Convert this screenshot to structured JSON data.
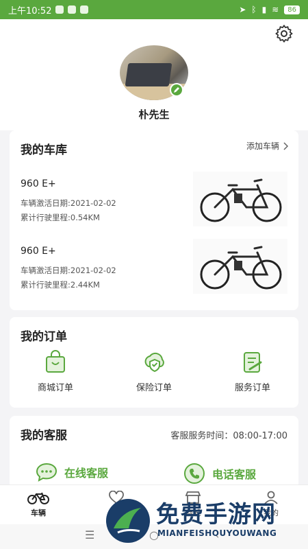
{
  "status_bar": {
    "time": "上午10:52",
    "battery": "86"
  },
  "profile": {
    "name": "朴先生"
  },
  "garage": {
    "title": "我的车库",
    "add_label": "添加车辆",
    "vehicles": [
      {
        "name": "960 E+",
        "activation": "车辆激活日期:2021-02-02",
        "mileage": "累计行驶里程:0.54KM"
      },
      {
        "name": "960 E+",
        "activation": "车辆激活日期:2021-02-02",
        "mileage": "累计行驶里程:2.44KM"
      }
    ]
  },
  "orders": {
    "title": "我的订单",
    "items": [
      {
        "label": "商城订单",
        "icon": "shopping-bag-icon"
      },
      {
        "label": "保险订单",
        "icon": "insurance-shield-icon"
      },
      {
        "label": "服务订单",
        "icon": "service-clipboard-icon"
      }
    ]
  },
  "service": {
    "title": "我的客服",
    "hours": "客服服务时间：08:00-17:00",
    "online_label": "在线客服",
    "phone_label": "电话客服"
  },
  "tabbar": {
    "tabs": [
      {
        "label": "车辆",
        "icon": "bicycle-icon",
        "active": true
      },
      {
        "label": "服务",
        "icon": "heart-icon",
        "active": false
      },
      {
        "label": "商城",
        "icon": "shop-icon",
        "active": false
      },
      {
        "label": "我的",
        "icon": "person-icon",
        "active": false
      }
    ]
  },
  "watermark": {
    "title": "免费手游网",
    "subtitle": "MIANFEISHOUYOUWANG"
  },
  "colors": {
    "accent": "#5aa83e",
    "watermark": "#1a3d68"
  }
}
